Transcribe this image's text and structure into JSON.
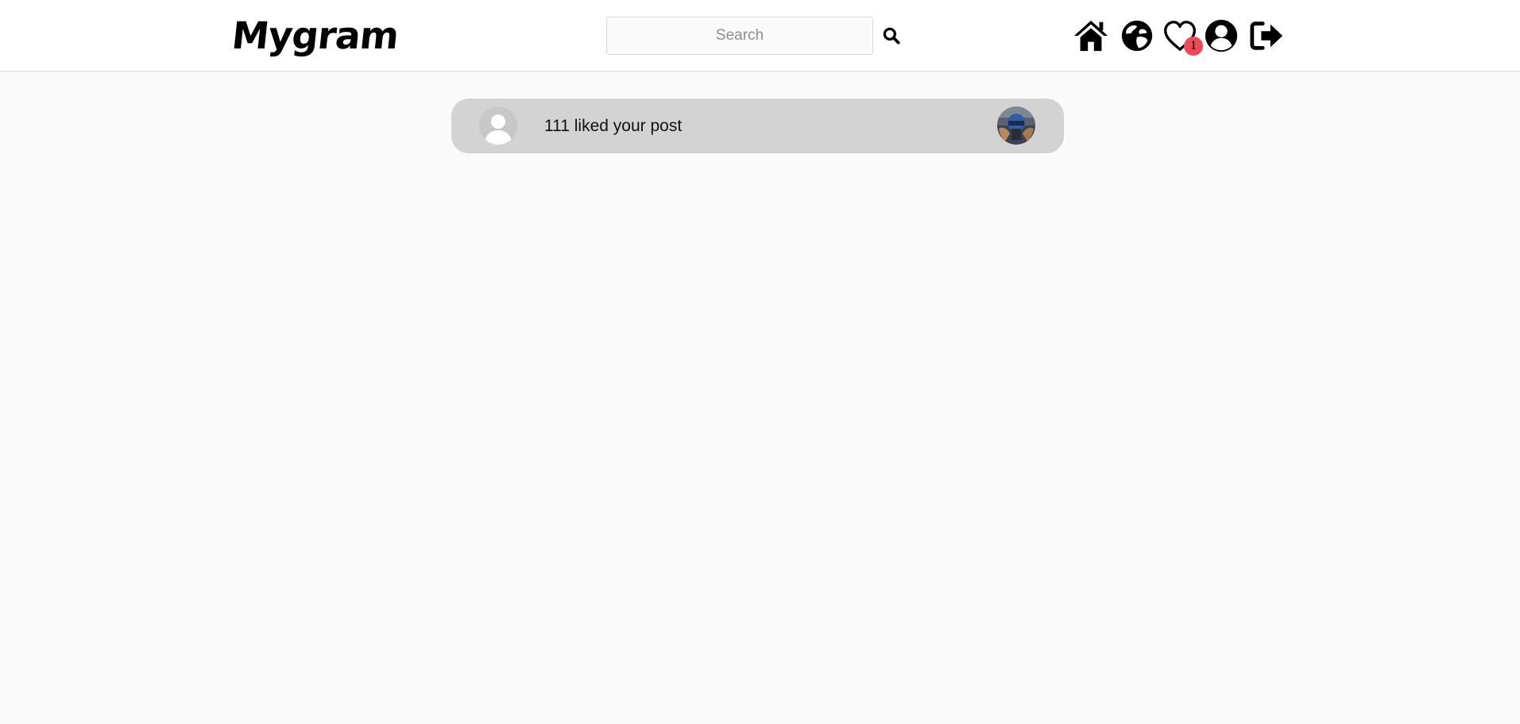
{
  "brand": {
    "logo_text": "Mygram"
  },
  "search": {
    "placeholder": "Search",
    "value": "",
    "button_icon": "search-icon"
  },
  "nav": {
    "items": [
      {
        "icon": "home-icon"
      },
      {
        "icon": "explore-globe-icon"
      },
      {
        "icon": "heart-icon",
        "badge": "1"
      },
      {
        "icon": "profile-icon"
      },
      {
        "icon": "logout-icon"
      }
    ]
  },
  "notifications": [
    {
      "avatar_icon": "default-user-avatar",
      "text": "111 liked your post",
      "post_thumbnail": "post-thumbnail"
    }
  ],
  "colors": {
    "page_bg": "#fafafa",
    "navbar_bg": "#ffffff",
    "card_bg": "#d3d3d3",
    "badge": "#ed4956"
  }
}
